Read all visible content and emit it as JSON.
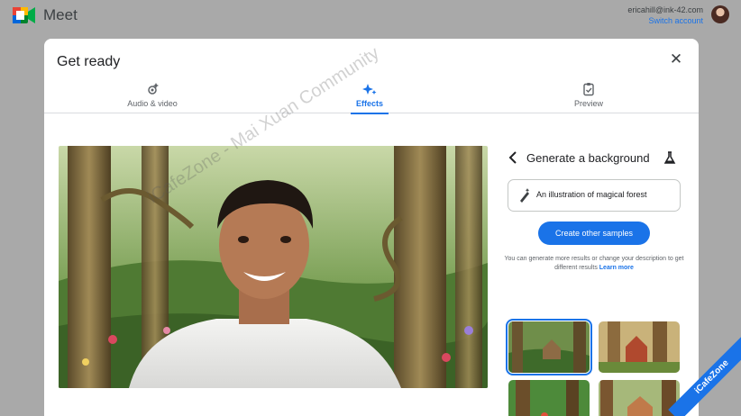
{
  "app": {
    "name": "Meet"
  },
  "account": {
    "email": "ericahill@ink-42.com",
    "switch_label": "Switch account"
  },
  "dialog": {
    "title": "Get ready",
    "tabs": [
      {
        "label": "Audio & video",
        "icon": "settings-sparkle-icon",
        "active": false
      },
      {
        "label": "Effects",
        "icon": "sparkle-icon",
        "active": true
      },
      {
        "label": "Preview",
        "icon": "clipboard-check-icon",
        "active": false
      }
    ]
  },
  "panel": {
    "title": "Generate a background",
    "prompt_text": "An illustration of magical forest",
    "create_button": "Create other samples",
    "helper_text": "You can generate more results or change your description to get different results",
    "learn_more": "Learn more",
    "samples": [
      {
        "name": "forest sample 1",
        "selected": true
      },
      {
        "name": "forest sample 2",
        "selected": false
      },
      {
        "name": "forest sample 3",
        "selected": false
      },
      {
        "name": "forest sample 4",
        "selected": false
      }
    ]
  },
  "overlay": {
    "watermark": "iCafeZone - Mai Xuan Community",
    "corner_brand": "iCafeZone"
  },
  "colors": {
    "accent": "#1a73e8",
    "backdrop": "#a9a9a9",
    "dialog": "#ffffff"
  }
}
